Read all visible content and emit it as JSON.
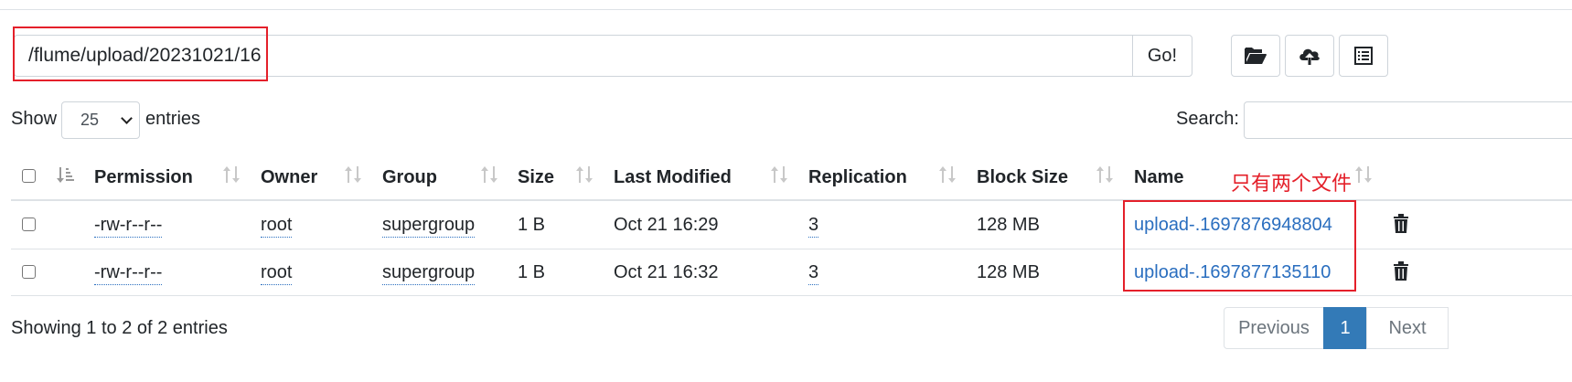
{
  "path_bar": {
    "value": "/flume/upload/20231021/16",
    "go_label": "Go!"
  },
  "toolbar": {
    "icons": [
      "folder-open-icon",
      "cloud-upload-icon",
      "list-icon"
    ]
  },
  "length_menu": {
    "show_label": "Show",
    "selected": "25",
    "entries_label": "entries"
  },
  "search": {
    "label": "Search:",
    "value": ""
  },
  "table": {
    "columns": [
      "Permission",
      "Owner",
      "Group",
      "Size",
      "Last Modified",
      "Replication",
      "Block Size",
      "Name"
    ],
    "rows": [
      {
        "permission": "-rw-r--r--",
        "owner": "root",
        "group": "supergroup",
        "size": "1 B",
        "modified": "Oct 21 16:29",
        "replication": "3",
        "block_size": "128 MB",
        "name": "upload-.1697876948804"
      },
      {
        "permission": "-rw-r--r--",
        "owner": "root",
        "group": "supergroup",
        "size": "1 B",
        "modified": "Oct 21 16:32",
        "replication": "3",
        "block_size": "128 MB",
        "name": "upload-.1697877135110"
      }
    ]
  },
  "annotation": {
    "note": "只有两个文件",
    "color": "#e4202a"
  },
  "footer": {
    "info": "Showing 1 to 2 of 2 entries",
    "previous": "Previous",
    "current_page": "1",
    "next": "Next"
  },
  "colors": {
    "link": "#2a6ebf",
    "active_page": "#337ab7",
    "border": "#dee2e6"
  }
}
